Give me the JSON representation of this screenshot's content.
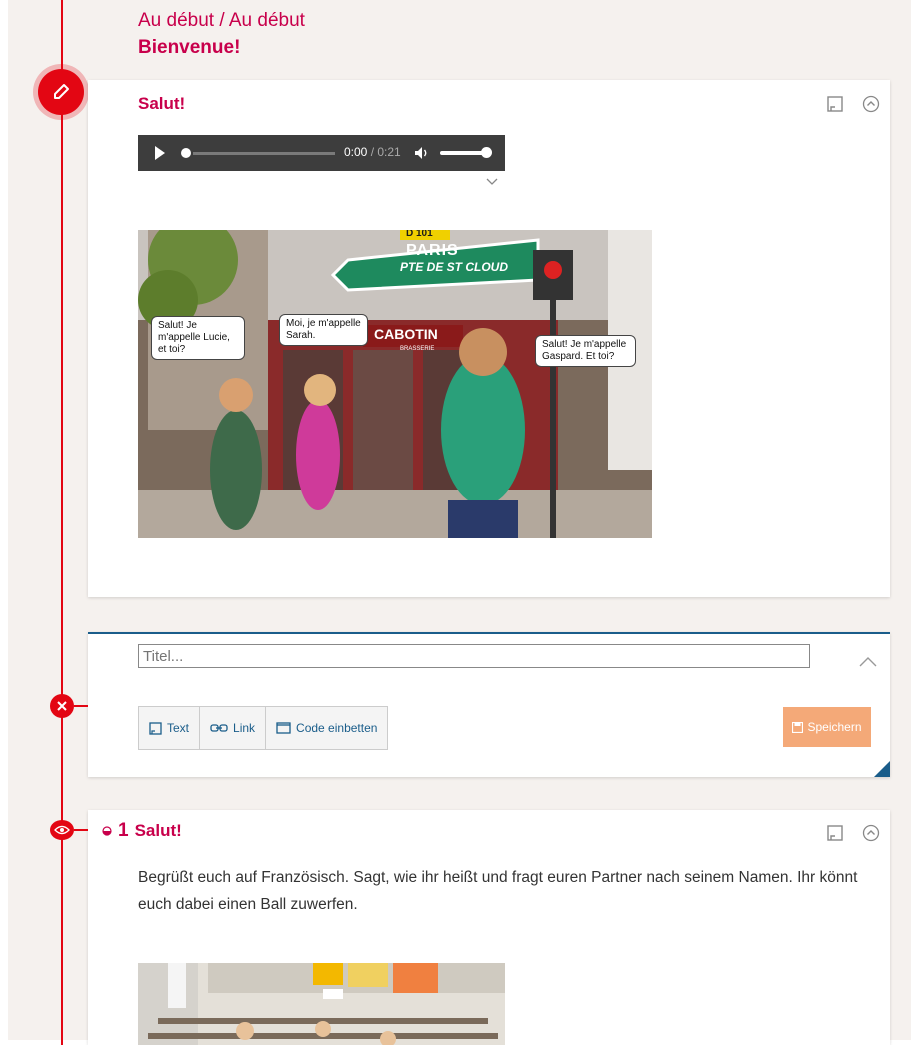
{
  "breadcrumb": {
    "path": "Au début / Au début",
    "chapter": "Bienvenue!"
  },
  "colors": {
    "accent": "#c8004b",
    "timeline": "#e30613",
    "link_blue": "#1a5d8a",
    "save_orange": "#f4a978"
  },
  "card_media": {
    "title": "Salut!",
    "audio": {
      "current": "0:00",
      "separator": " / ",
      "duration": "0:21"
    },
    "image": {
      "bubbles": [
        {
          "text": "Salut! Je m'appelle Lucie, et toi?"
        },
        {
          "text": "Moi, je m'appelle Sarah."
        },
        {
          "text": "Salut! Je m'appelle Gaspard. Et toi?"
        }
      ],
      "sign_text": "PARIS",
      "sign_sub": "PTE DE ST CLOUD",
      "sign_top": "D 101",
      "cafe": "CABOTIN",
      "brasserie": "BRASSERIE"
    }
  },
  "editor": {
    "title_placeholder": "Titel...",
    "buttons": [
      {
        "label": "Text",
        "icon": "note-icon"
      },
      {
        "label": "Link",
        "icon": "link-icon"
      },
      {
        "label": "Code einbetten",
        "icon": "embed-icon"
      }
    ],
    "save_label": "Speichern"
  },
  "card_task": {
    "number": "1",
    "title": "Salut!",
    "text": "Begrüßt euch auf Französisch. Sagt, wie ihr heißt und fragt euren Partner nach seinem Namen. Ihr könnt euch dabei einen Ball zuwerfen."
  }
}
